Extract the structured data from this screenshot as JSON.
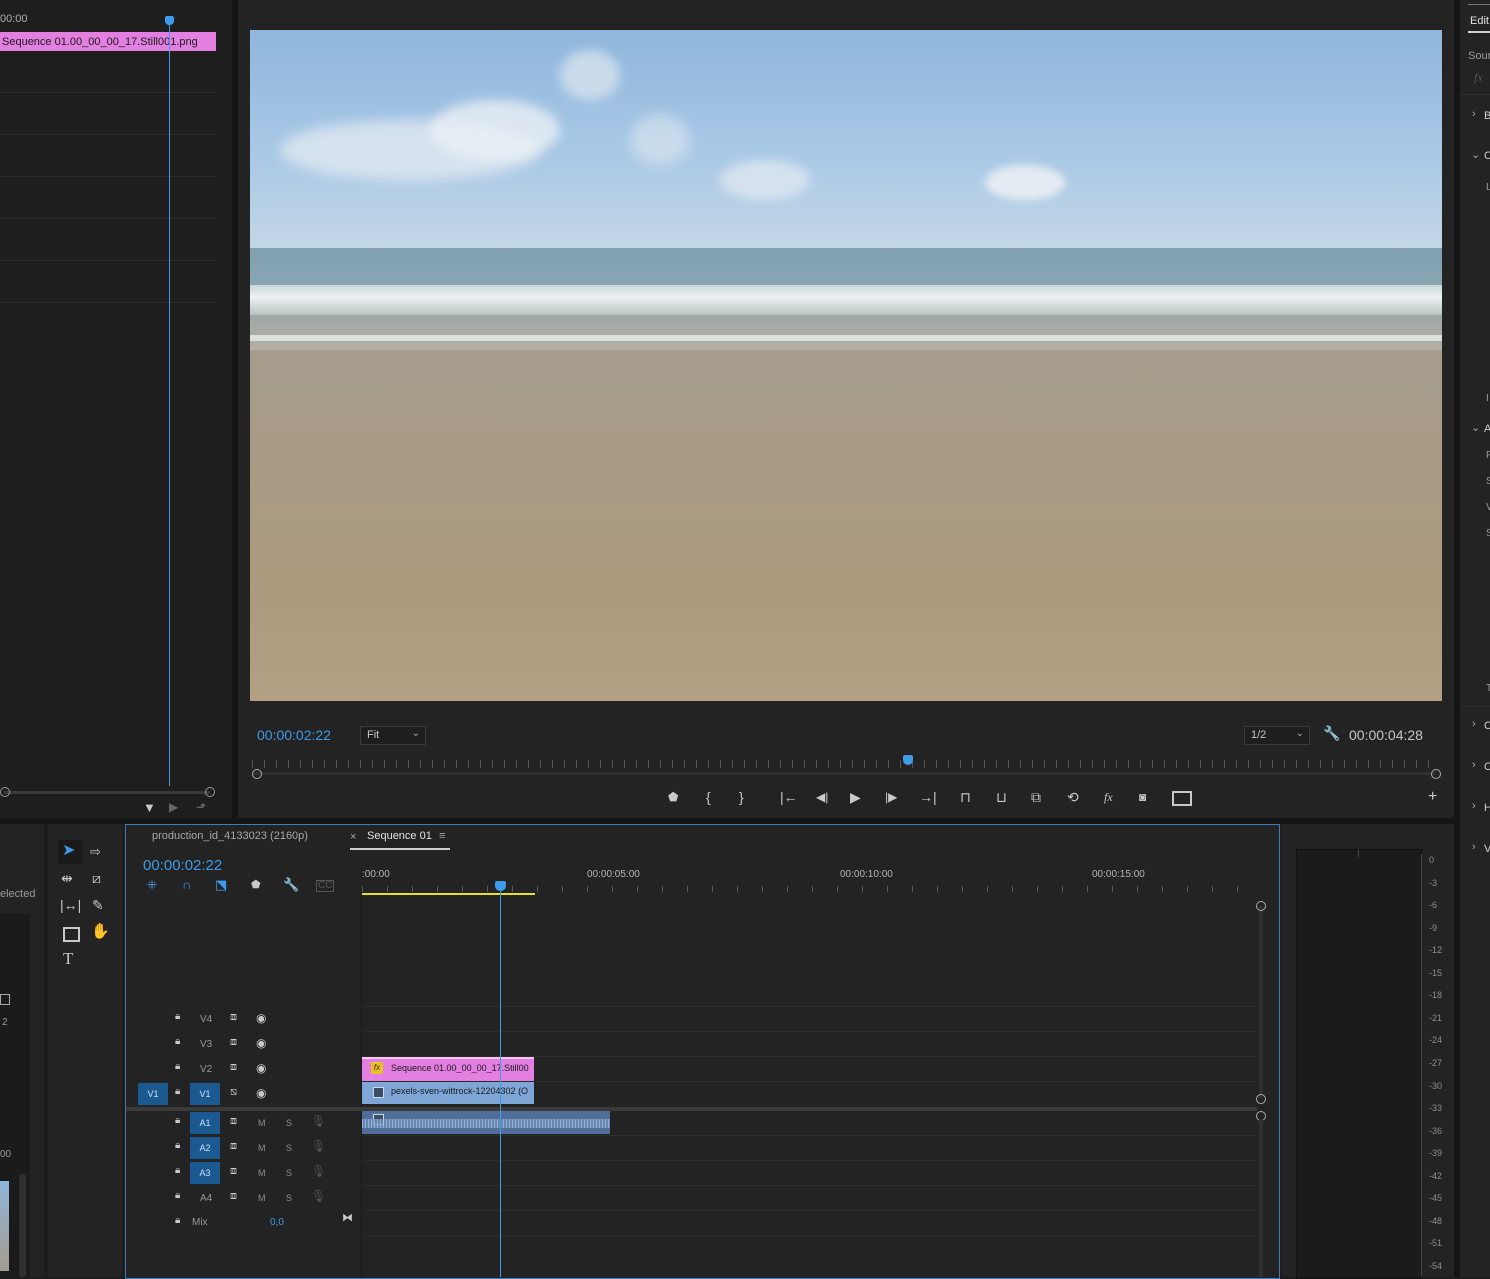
{
  "source_monitor": {
    "timecode": "00:00",
    "clip_label": "Sequence 01.00_00_00_17.Still001.png"
  },
  "program_monitor": {
    "timecode_current": "00:00:02:22",
    "fit_label": "Fit",
    "resolution_label": "1/2",
    "timecode_duration": "00:00:04:28"
  },
  "right_panel": {
    "tab_label": "Edit",
    "source_label": "Sour",
    "fx_label": "fx",
    "section_letters": [
      "B",
      "C",
      "L",
      "I",
      "A",
      "F",
      "S",
      "V",
      "S",
      "T",
      "C",
      "C",
      "H",
      "V"
    ]
  },
  "project_panel": {
    "selected_label": "elected",
    "number_label_1": "2",
    "number_label_2": "00"
  },
  "timeline": {
    "tab_inactive": "production_id_4133023 (2160p)",
    "tab_active": "Sequence 01",
    "timecode": "00:00:02:22",
    "ruler_labels": [
      ":00:00",
      "00:00:05:00",
      "00:00:10:00",
      "00:00:15:00"
    ],
    "video_tracks": [
      {
        "name": "V4",
        "source": ""
      },
      {
        "name": "V3",
        "source": ""
      },
      {
        "name": "V2",
        "source": ""
      },
      {
        "name": "V1",
        "source": "V1"
      }
    ],
    "audio_tracks": [
      {
        "name": "A1",
        "mute": "M",
        "solo": "S"
      },
      {
        "name": "A2",
        "mute": "M",
        "solo": "S"
      },
      {
        "name": "A3",
        "mute": "M",
        "solo": "S"
      },
      {
        "name": "A4",
        "mute": "M",
        "solo": "S"
      }
    ],
    "mix_label": "Mix",
    "mix_value": "0,0",
    "clip_v2": "Sequence 01.00_00_00_17.Still00",
    "clip_v1": "pexels-sven-wittrock-12204302 (O",
    "clip_fx_badge": "fx"
  },
  "audio_meter": {
    "scale": [
      "0",
      "-3",
      "-6",
      "-9",
      "-12",
      "-15",
      "-18",
      "-21",
      "-24",
      "-27",
      "-30",
      "-33",
      "-36",
      "-39",
      "-42",
      "-45",
      "-48",
      "-51",
      "-54"
    ]
  },
  "colors": {
    "accent_blue": "#3d9be9",
    "clip_pink": "#e37fe0",
    "clip_blue": "#7ea6d6",
    "target_blue": "#1a5a91",
    "workarea_yellow": "#e6e22a"
  }
}
